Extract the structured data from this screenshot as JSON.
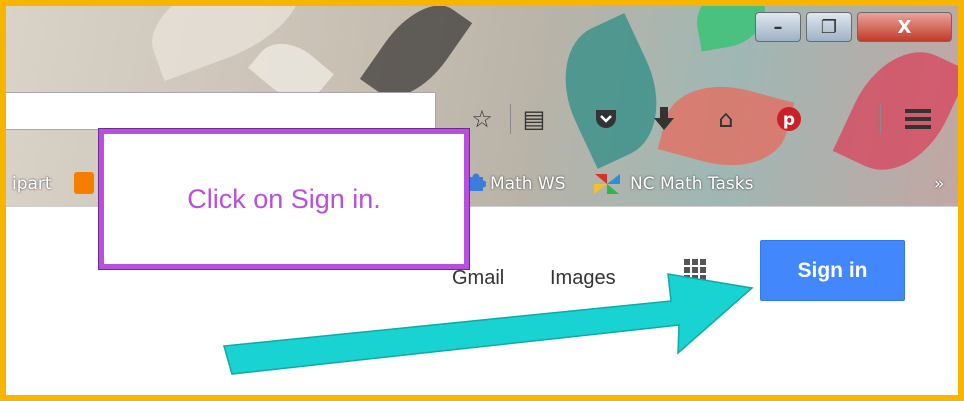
{
  "window_controls": {
    "minimize": "–",
    "maximize": "❐",
    "close": "X"
  },
  "toolbar": {
    "icons": [
      "star-icon",
      "reading-list-icon",
      "pocket-icon",
      "download-icon",
      "home-icon",
      "pinterest-icon",
      "menu-icon"
    ]
  },
  "bookmarks": {
    "items": [
      {
        "label": "ipart"
      },
      {
        "label": "Math WS"
      },
      {
        "label": "NC Math Tasks"
      }
    ],
    "overflow": "»"
  },
  "google": {
    "gmail": "Gmail",
    "images": "Images",
    "sign_in": "Sign in"
  },
  "callout": {
    "text": "Click on Sign in."
  },
  "colors": {
    "border": "#f7b500",
    "callout": "#b94fe0",
    "arrow": "#19d3d3",
    "sign_in": "#4387fd"
  }
}
